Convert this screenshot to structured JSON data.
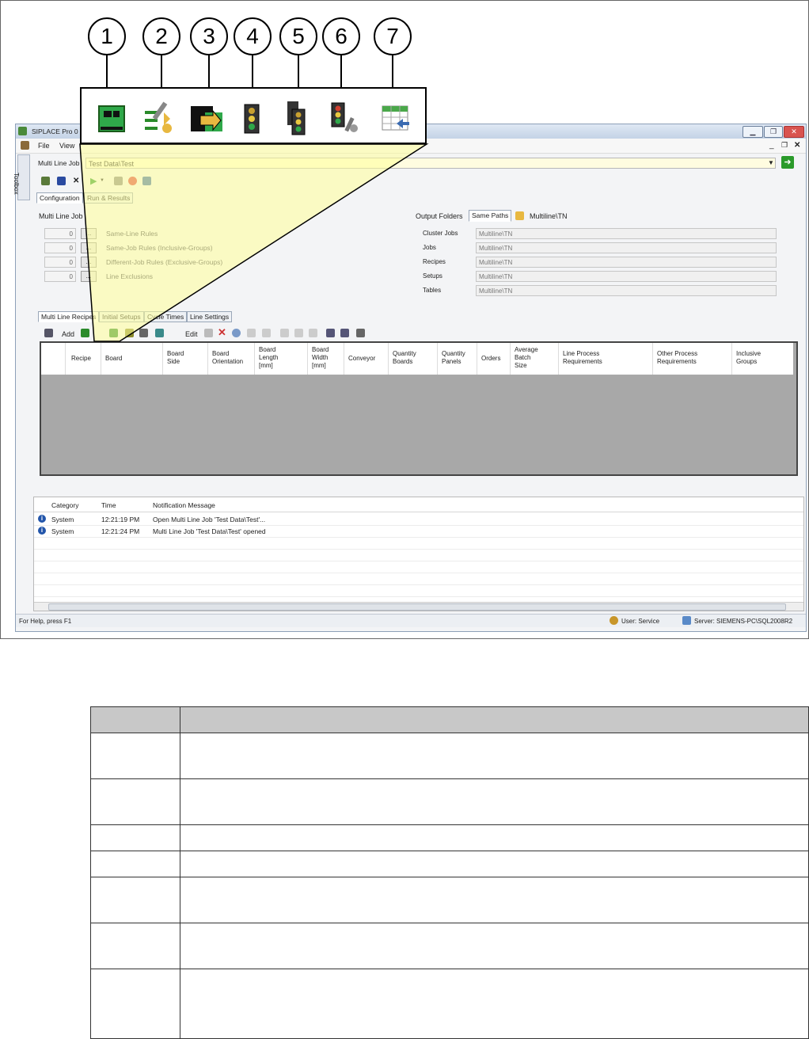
{
  "callouts": [
    "1",
    "2",
    "3",
    "4",
    "5",
    "6",
    "7"
  ],
  "window": {
    "title": "SIPLACE Pro 0",
    "menu": [
      "File",
      "View"
    ],
    "toolbox_tab": "Toolbox"
  },
  "job": {
    "label": "Multi Line Job",
    "value": "Test Data\\Test"
  },
  "top_tabs": [
    "Configuration",
    "Run & Results"
  ],
  "rules_section": {
    "title": "Multi Line Job",
    "rows": [
      {
        "count": "0",
        "button": "...",
        "label": "Same-Line Rules"
      },
      {
        "count": "0",
        "button": "...",
        "label": "Same-Job Rules (Inclusive-Groups)"
      },
      {
        "count": "0",
        "button": "...",
        "label": "Different-Job Rules (Exclusive-Groups)"
      },
      {
        "count": "0",
        "button": "...",
        "label": "Line Exclusions"
      }
    ]
  },
  "output_folders": {
    "label": "Output Folders",
    "same_paths_button": "Same Paths",
    "root_path": "Multiline\\TN",
    "rows": [
      {
        "label": "Cluster Jobs",
        "value": "Multiline\\TN"
      },
      {
        "label": "Jobs",
        "value": "Multiline\\TN"
      },
      {
        "label": "Recipes",
        "value": "Multiline\\TN"
      },
      {
        "label": "Setups",
        "value": "Multiline\\TN"
      },
      {
        "label": "Tables",
        "value": "Multiline\\TN"
      }
    ]
  },
  "sub_tabs": [
    "Multi Line Recipes",
    "Initial Setups",
    "Cycle Times",
    "Line Settings"
  ],
  "grid_toolbar": {
    "add": "Add",
    "edit": "Edit"
  },
  "grid_columns": [
    "Recipe",
    "Board",
    "Board\nSide",
    "Board\nOrientation",
    "Board\nLength\n[mm]",
    "Board\nWidth\n[mm]",
    "Conveyor",
    "Quantity\nBoards",
    "Quantity\nPanels",
    "Orders",
    "Average\nBatch\nSize",
    "Line Process\nRequirements",
    "Other Process\nRequirements",
    "Inclusive\nGroups"
  ],
  "log": {
    "headers": [
      "Category",
      "Time",
      "Notification Message"
    ],
    "rows": [
      {
        "category": "System",
        "time": "12:21:19 PM",
        "message": "Open Multi Line Job 'Test Data\\Test'..."
      },
      {
        "category": "System",
        "time": "12:21:24 PM",
        "message": "Multi Line Job 'Test Data\\Test' opened"
      }
    ]
  },
  "status": {
    "help": "For Help, press F1",
    "user": "User: Service",
    "server": "Server: SIEMENS-PC\\SQL2008R2"
  },
  "colors": {
    "highlight": "#ffff99",
    "accent_green": "#2a9a2a"
  }
}
